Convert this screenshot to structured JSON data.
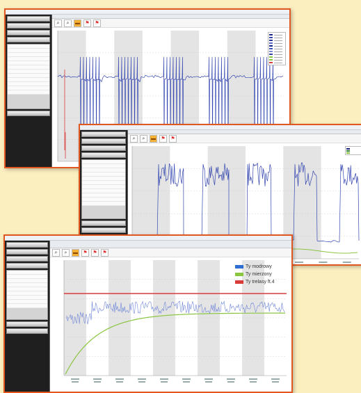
{
  "colors": {
    "background": "#fbeebf",
    "window_border": "#e0581f",
    "signal_blue": "#3547b0",
    "spike_red": "#d93a3a",
    "green": "#8ac640",
    "shade": "#e4e4e4"
  },
  "window3": {
    "legend": [
      {
        "label": "Ty modrowy",
        "color": "#2f6fd4"
      },
      {
        "label": "Ty mierzony",
        "color": "#8ac640"
      },
      {
        "label": "Ty trelasy ft.4",
        "color": "#d93a3a"
      }
    ]
  }
}
